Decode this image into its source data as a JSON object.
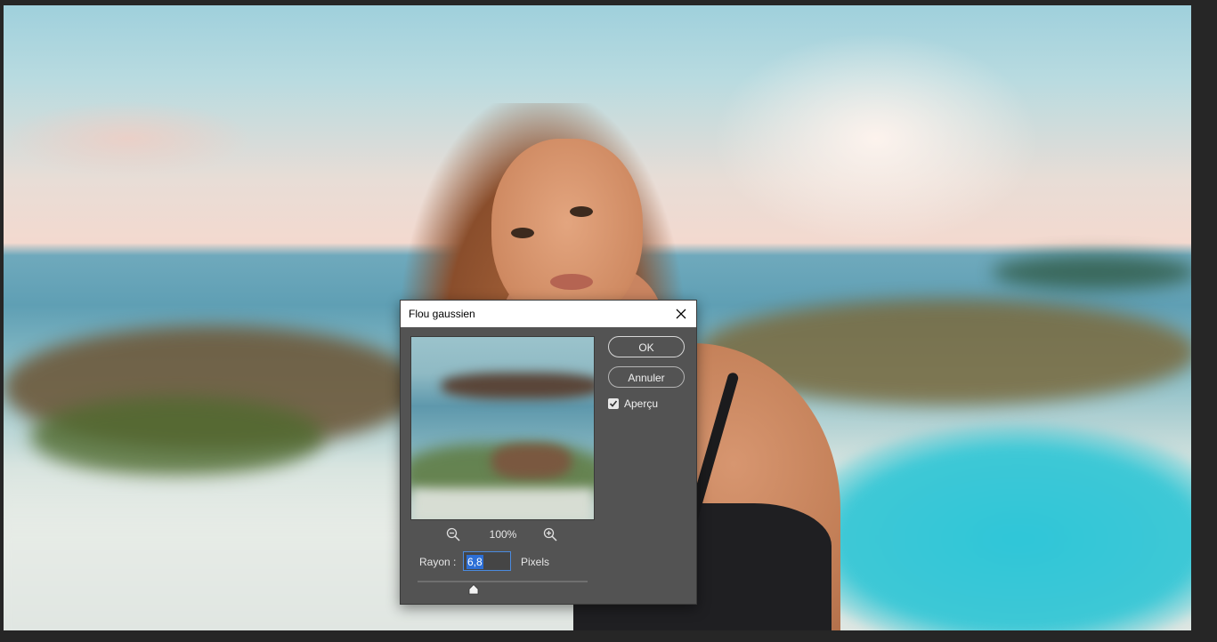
{
  "dialog": {
    "title": "Flou gaussien",
    "zoom_level": "100%",
    "ok_label": "OK",
    "cancel_label": "Annuler",
    "preview_checkbox": {
      "label": "Aperçu",
      "checked": true
    },
    "radius": {
      "label": "Rayon :",
      "value": "6,8",
      "unit": "Pixels"
    },
    "slider_position": 0.33,
    "icons": [
      "close-icon",
      "zoom-out-icon",
      "zoom-in-icon",
      "checkmark-icon",
      "slider-thumb-icon"
    ]
  },
  "colors": {
    "dialog_bg": "#535353",
    "titlebar_bg": "#ffffff",
    "input_border": "#4a8be0",
    "selection": "#2d6fd6",
    "workspace_bg": "#262626"
  }
}
